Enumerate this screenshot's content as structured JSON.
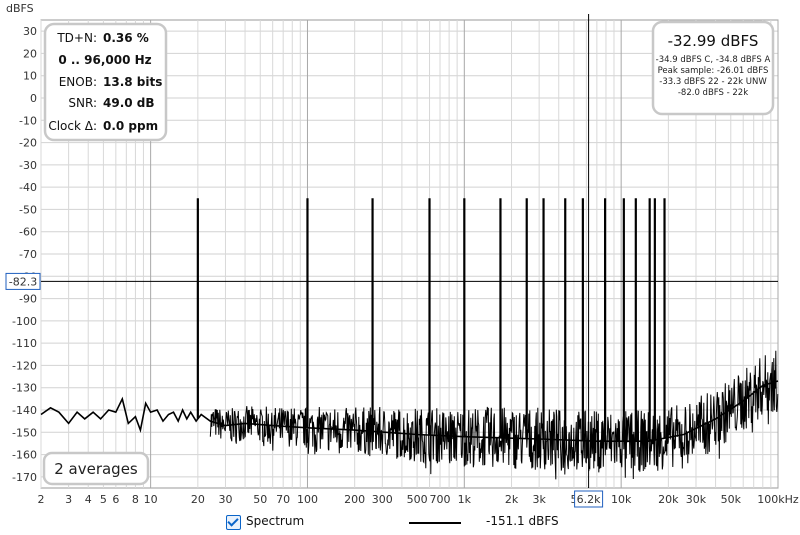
{
  "chart_data": {
    "type": "line",
    "xscale": "log",
    "xlim": [
      2,
      100000
    ],
    "ylim": [
      -175,
      35
    ],
    "ylabel": "dBFS",
    "y_ticks": [
      30,
      20,
      10,
      0,
      -10,
      -20,
      -30,
      -40,
      -50,
      -60,
      -70,
      -80,
      -90,
      -100,
      -110,
      -120,
      -130,
      -140,
      -150,
      -160,
      -170
    ],
    "x_ticks": [
      {
        "v": 2,
        "label": "2"
      },
      {
        "v": 3,
        "label": "3"
      },
      {
        "v": 4,
        "label": "4"
      },
      {
        "v": 5,
        "label": "5"
      },
      {
        "v": 6,
        "label": "6"
      },
      {
        "v": 8,
        "label": "8"
      },
      {
        "v": 10,
        "label": "10"
      },
      {
        "v": 20,
        "label": "20"
      },
      {
        "v": 30,
        "label": "30"
      },
      {
        "v": 50,
        "label": "50"
      },
      {
        "v": 70,
        "label": "70"
      },
      {
        "v": 100,
        "label": "100"
      },
      {
        "v": 200,
        "label": "200"
      },
      {
        "v": 300,
        "label": "300"
      },
      {
        "v": 500,
        "label": "500"
      },
      {
        "v": 700,
        "label": "700"
      },
      {
        "v": 1000,
        "label": "1k"
      },
      {
        "v": 2000,
        "label": "2k"
      },
      {
        "v": 3000,
        "label": "3k"
      },
      {
        "v": 5000,
        "label": "5"
      },
      {
        "v": 10000,
        "label": "10k"
      },
      {
        "v": 20000,
        "label": "20k"
      },
      {
        "v": 30000,
        "label": "30k"
      },
      {
        "v": 50000,
        "label": "50k"
      },
      {
        "v": 100000,
        "label": "100kHz"
      }
    ],
    "series": [
      {
        "name": "Spectrum",
        "color": "#000000",
        "peaks": [
          {
            "x": 20,
            "y": -45
          },
          {
            "x": 100,
            "y": -45
          },
          {
            "x": 260,
            "y": -45
          },
          {
            "x": 600,
            "y": -45
          },
          {
            "x": 1000,
            "y": -45
          },
          {
            "x": 1700,
            "y": -45
          },
          {
            "x": 2500,
            "y": -45
          },
          {
            "x": 3200,
            "y": -45
          },
          {
            "x": 4400,
            "y": -45
          },
          {
            "x": 5700,
            "y": -45
          },
          {
            "x": 7900,
            "y": -45
          },
          {
            "x": 10400,
            "y": -45
          },
          {
            "x": 12400,
            "y": -45
          },
          {
            "x": 15200,
            "y": -45
          },
          {
            "x": 16400,
            "y": -45
          },
          {
            "x": 18900,
            "y": -45
          }
        ],
        "noise_floor": [
          {
            "x": 2,
            "y": -142
          },
          {
            "x": 2.3,
            "y": -139
          },
          {
            "x": 2.6,
            "y": -141
          },
          {
            "x": 3,
            "y": -146
          },
          {
            "x": 3.4,
            "y": -141
          },
          {
            "x": 3.8,
            "y": -144
          },
          {
            "x": 4.3,
            "y": -141
          },
          {
            "x": 4.8,
            "y": -144
          },
          {
            "x": 5.4,
            "y": -140
          },
          {
            "x": 6,
            "y": -141
          },
          {
            "x": 6.6,
            "y": -135
          },
          {
            "x": 7.2,
            "y": -146
          },
          {
            "x": 8,
            "y": -143
          },
          {
            "x": 8.6,
            "y": -149
          },
          {
            "x": 9.3,
            "y": -137
          },
          {
            "x": 10,
            "y": -141
          },
          {
            "x": 11,
            "y": -140
          },
          {
            "x": 12,
            "y": -145
          },
          {
            "x": 13,
            "y": -142
          },
          {
            "x": 14,
            "y": -141
          },
          {
            "x": 15,
            "y": -145
          },
          {
            "x": 16,
            "y": -140
          },
          {
            "x": 17,
            "y": -144
          },
          {
            "x": 18,
            "y": -141
          },
          {
            "x": 19.5,
            "y": -145
          },
          {
            "x": 21,
            "y": -142
          },
          {
            "x": 24,
            "y": -145
          },
          {
            "x": 30,
            "y": -147
          },
          {
            "x": 40,
            "y": -146
          },
          {
            "x": 60,
            "y": -147
          },
          {
            "x": 100,
            "y": -148
          },
          {
            "x": 200,
            "y": -149
          },
          {
            "x": 500,
            "y": -151
          },
          {
            "x": 1000,
            "y": -152
          },
          {
            "x": 3000,
            "y": -153
          },
          {
            "x": 7000,
            "y": -154
          },
          {
            "x": 15000,
            "y": -154
          },
          {
            "x": 25000,
            "y": -151
          },
          {
            "x": 40000,
            "y": -144
          },
          {
            "x": 60000,
            "y": -136
          },
          {
            "x": 80000,
            "y": -129
          },
          {
            "x": 100000,
            "y": -127
          }
        ]
      }
    ],
    "cursor": {
      "y_label": "-82.3",
      "y": -82.3,
      "x_label": "6.2k",
      "x": 6200
    }
  },
  "stats_panel": {
    "rows": [
      {
        "label": "TD+N:",
        "value": "0.36 %"
      },
      {
        "label": "",
        "value": "0 .. 96,000 Hz"
      },
      {
        "label": "ENOB:",
        "value": "13.8 bits"
      },
      {
        "label": "SNR:",
        "value": "49.0 dB"
      },
      {
        "label": "Clock Δ:",
        "value": "0.0 ppm"
      }
    ]
  },
  "level_panel": {
    "main": "-32.99 dBFS",
    "lines": [
      "-34.9 dBFS C, -34.8 dBFS A",
      "Peak sample: -26.01 dBFS",
      "-33.3 dBFS 22 - 22k UNW",
      "-82.0 dBFS - 22k"
    ]
  },
  "averages_label": "2 averages",
  "legend": {
    "label": "Spectrum",
    "value": "-151.1 dBFS",
    "color": "#000000"
  }
}
